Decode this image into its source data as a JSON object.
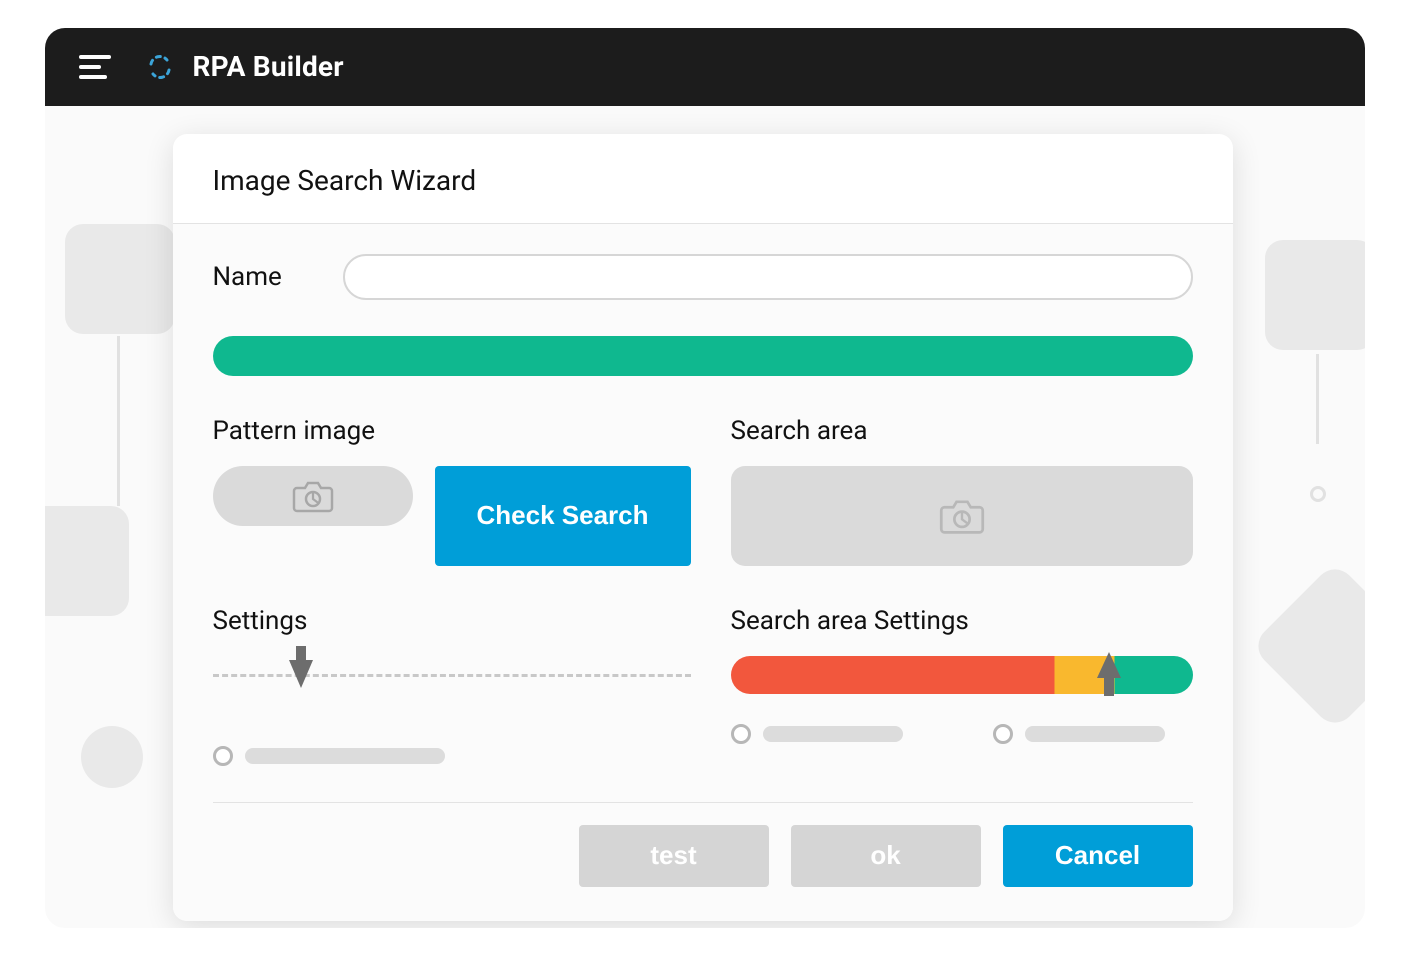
{
  "app": {
    "title": "RPA Builder"
  },
  "dialog": {
    "title": "Image Search Wizard",
    "name_label": "Name",
    "name_value": "",
    "pattern_image_label": "Pattern image",
    "check_search_label": "Check Search",
    "search_area_label": "Search area",
    "settings_label": "Settings",
    "search_area_settings_label": "Search area Settings",
    "buttons": {
      "test": "test",
      "ok": "ok",
      "cancel": "Cancel"
    }
  },
  "colors": {
    "teal": "#0fb88f",
    "blue": "#009ed8",
    "orange": "#f2573d",
    "yellow": "#f9b82e"
  }
}
